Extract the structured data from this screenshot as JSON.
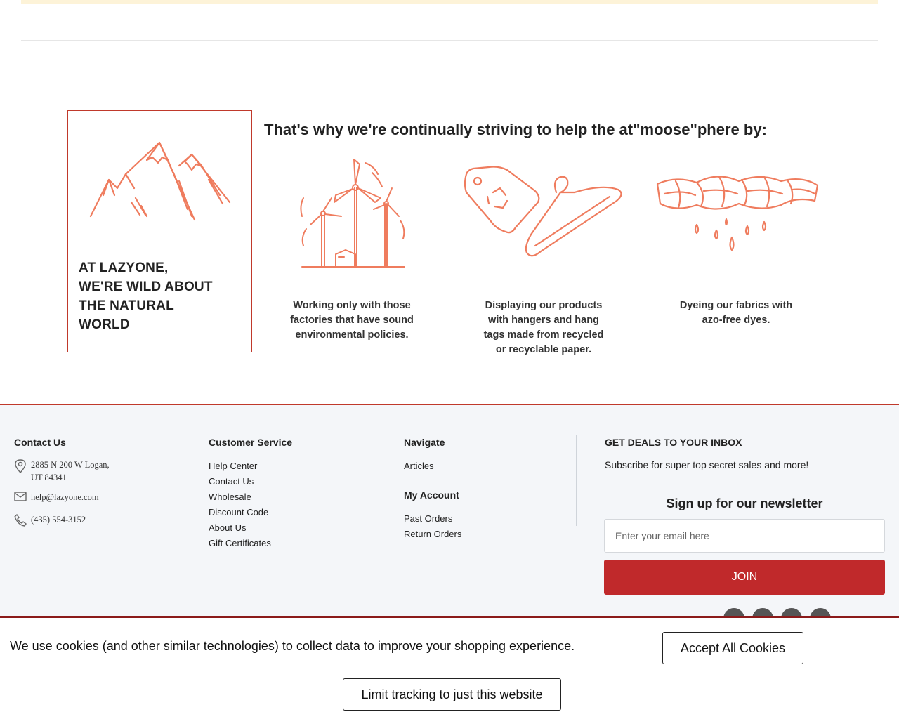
{
  "wild": {
    "line1": "AT LAZYONE,",
    "line2": "WE'RE WILD ABOUT",
    "line3": "THE NATURAL",
    "line4": "WORLD"
  },
  "atmosphere": {
    "title": "That's why we're continually striving to help the at\"moose\"phere by:",
    "features": [
      {
        "icon": "wind-turbines-icon",
        "text": "Working only with those factories that have sound environmental policies."
      },
      {
        "icon": "recycled-tag-hanger-icon",
        "text": "Displaying our products with hangers and hang tags made from recycled or recyclable paper."
      },
      {
        "icon": "dyed-fabric-icon",
        "text": "Dyeing our fabrics with azo-free dyes."
      }
    ]
  },
  "footer": {
    "contact": {
      "heading": "Contact Us",
      "address_line1": "2885 N 200 W Logan,",
      "address_line2": "UT 84341",
      "email": "help@lazyone.com",
      "phone": "(435) 554-3152"
    },
    "customer_service": {
      "heading": "Customer Service",
      "links": [
        "Help Center",
        "Contact Us",
        "Wholesale",
        "Discount Code",
        "About Us",
        "Gift Certificates"
      ]
    },
    "navigate": {
      "heading": "Navigate",
      "links": [
        "Articles"
      ]
    },
    "my_account": {
      "heading": "My Account",
      "links": [
        "Past Orders",
        "Return Orders"
      ]
    },
    "newsletter": {
      "heading": "GET DEALS TO YOUR INBOX",
      "subtitle": "Subscribe for super top secret sales and more!",
      "signup_title": "Sign up for our newsletter",
      "email_placeholder": "Enter your email here",
      "join_label": "JOIN"
    }
  },
  "cookie": {
    "message": "We use cookies (and other similar technologies) to collect data to improve your shopping experience.",
    "accept_label": "Accept All Cookies",
    "limit_label": "Limit tracking to just this website"
  },
  "colors": {
    "accent": "#c0292b",
    "illustration": "#ef7c5e"
  }
}
